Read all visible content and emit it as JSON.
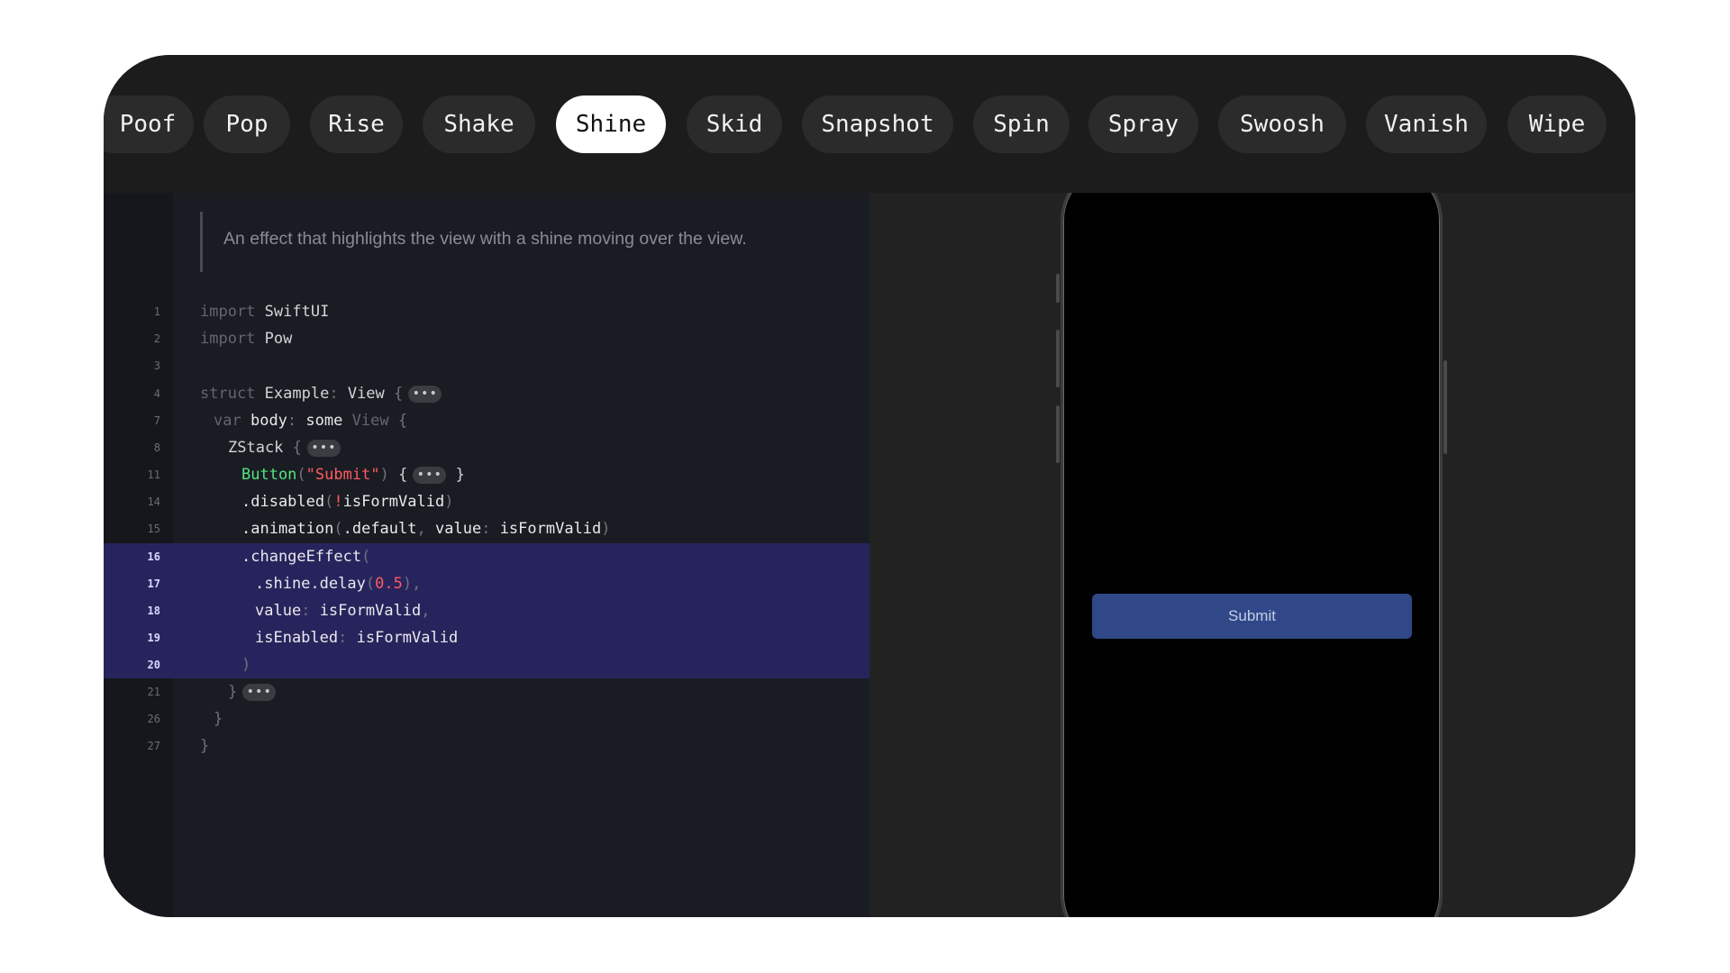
{
  "effects": {
    "items": [
      "Poof",
      "Pop",
      "Rise",
      "Shake",
      "Shine",
      "Skid",
      "Snapshot",
      "Spin",
      "Spray",
      "Swoosh",
      "Vanish",
      "Wipe"
    ],
    "selected": "Shine"
  },
  "code": {
    "doc": "An effect that highlights the view with a shine moving over the view.",
    "line_numbers": [
      "1",
      "2",
      "3",
      "4",
      "7",
      "8",
      "11",
      "14",
      "15",
      "16",
      "17",
      "18",
      "19",
      "20",
      "21",
      "26",
      "27"
    ],
    "highlighted_lines": [
      "16",
      "17",
      "18",
      "19",
      "20"
    ],
    "tokens": {
      "import": "import",
      "swiftui": "SwiftUI",
      "pow": "Pow",
      "struct": "struct",
      "example": "Example",
      "colon": ":",
      "view": "View",
      "brace_open": "{",
      "brace_close": "}",
      "var": "var",
      "body": "body",
      "some": "some",
      "zstack": "ZStack",
      "button": "Button",
      "paren_open": "(",
      "paren_close": ")",
      "submit_str": "\"Submit\"",
      "disabled": ".disabled",
      "bang": "!",
      "is_form_valid": "isFormValid",
      "animation": ".animation",
      "default": ".default",
      "comma": ",",
      "value": "value",
      "change_effect": ".changeEffect",
      "shine": ".shine",
      "delay": ".delay",
      "half": "0.5",
      "is_enabled": "isEnabled",
      "fold": "•••"
    }
  },
  "preview": {
    "submit_label": "Submit"
  },
  "colors": {
    "selected_pill": "#ffffff",
    "pill": "#2b2b2b",
    "highlight": "#27245d",
    "function": "#55e37e",
    "string": "#ff5a60",
    "button": "#304888"
  }
}
